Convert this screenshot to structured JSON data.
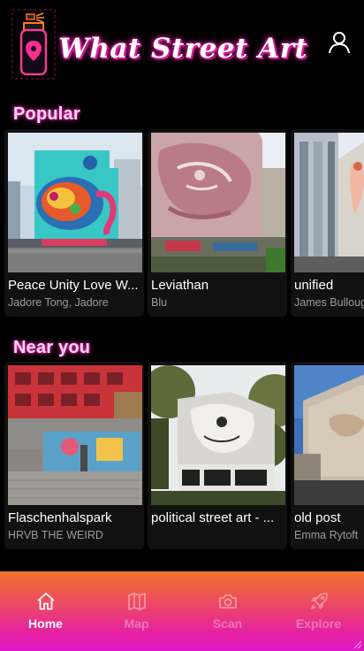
{
  "header": {
    "title": "What Street Art",
    "logo_icon": "spray-can-location-icon",
    "profile_icon": "user-icon"
  },
  "sections": {
    "popular": {
      "title": "Popular",
      "cards": [
        {
          "title": "Peace Unity Love W...",
          "artist": "Jadore Tong, Jadore"
        },
        {
          "title": "Leviathan",
          "artist": "Blu"
        },
        {
          "title": "unified",
          "artist": "James Bullough"
        }
      ]
    },
    "near_you": {
      "title": "Near you",
      "cards": [
        {
          "title": "Flaschenhalspark",
          "artist": "HRVB THE WEIRD"
        },
        {
          "title": "political street art - ...",
          "artist": ""
        },
        {
          "title": "old post",
          "artist": "Emma Rytoft"
        }
      ]
    }
  },
  "nav": {
    "items": [
      {
        "label": "Home",
        "icon": "home-icon",
        "active": true
      },
      {
        "label": "Map",
        "icon": "map-icon",
        "active": false
      },
      {
        "label": "Scan",
        "icon": "camera-icon",
        "active": false
      },
      {
        "label": "Explore",
        "icon": "rocket-icon",
        "active": false
      }
    ]
  },
  "colors": {
    "background": "#000000",
    "card": "#111111",
    "section_title": "#ffd2ee",
    "title_glow": "#ff2fb8",
    "nav_gradient_top": "#f0732a",
    "nav_gradient_bottom": "#de17c4"
  }
}
